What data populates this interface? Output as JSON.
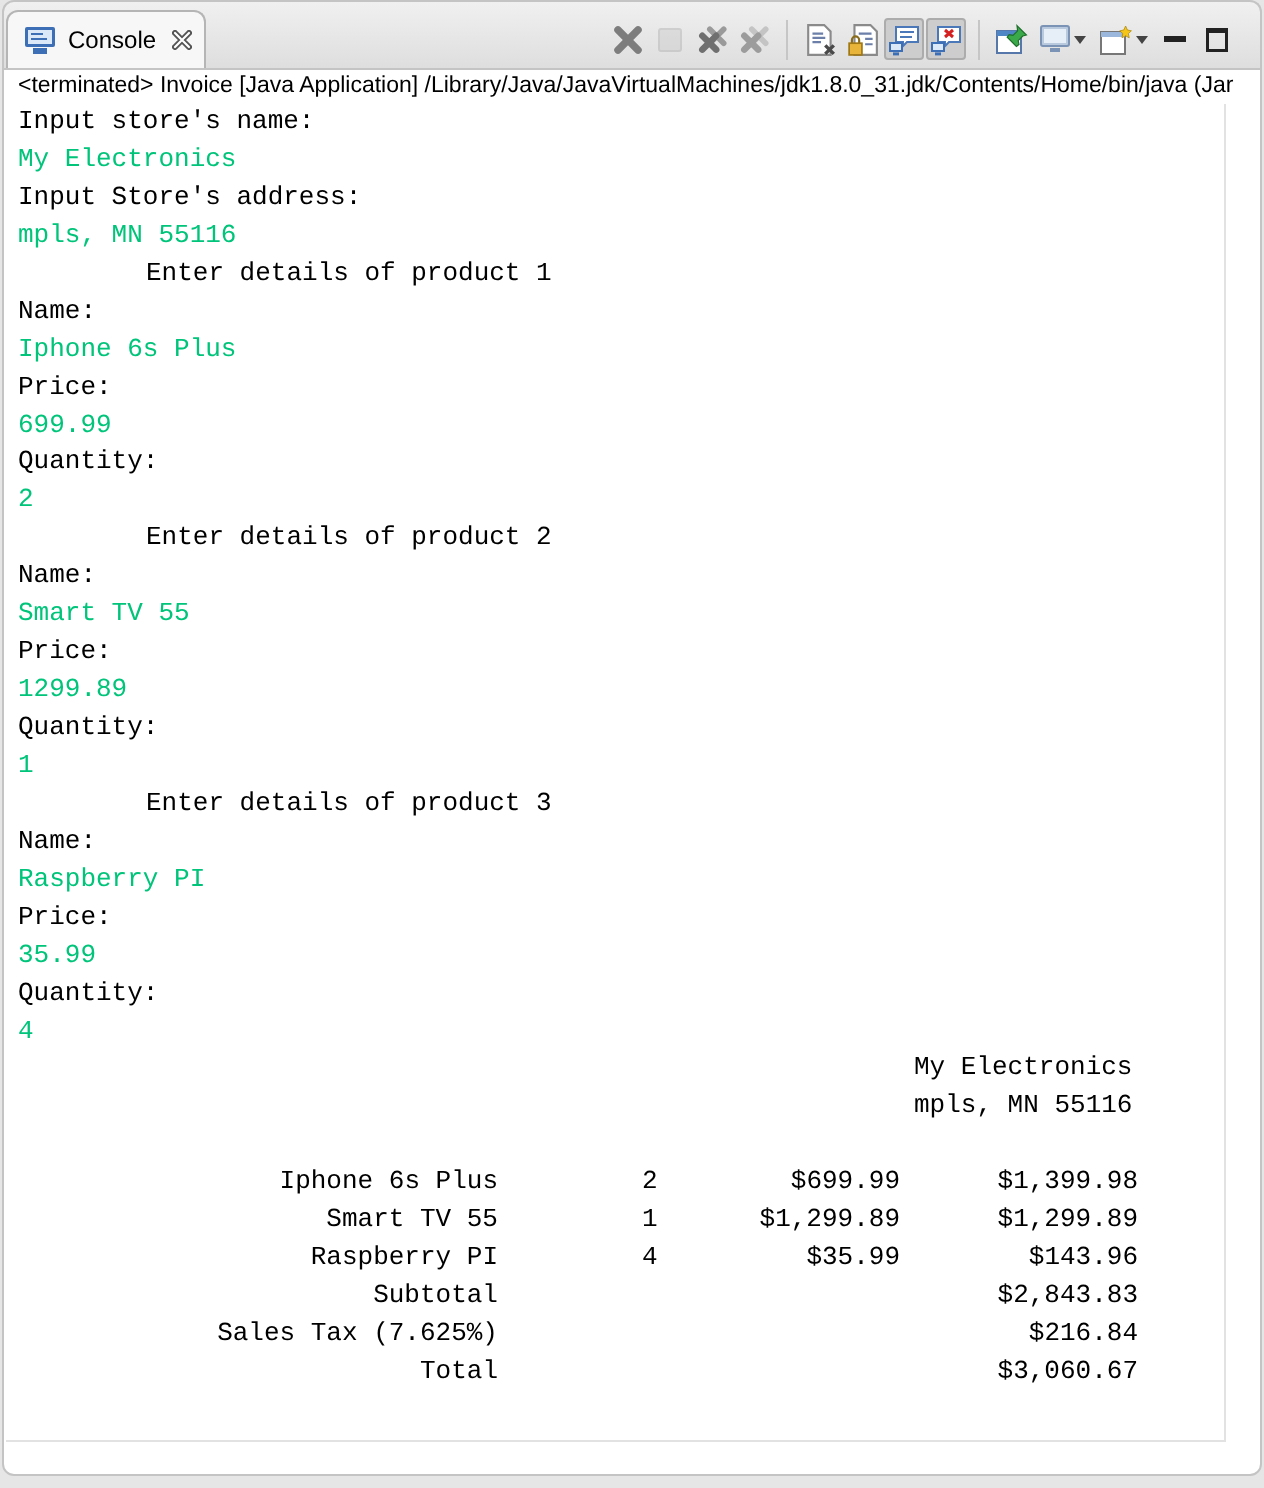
{
  "tabs": [
    {
      "label": "Console",
      "selected": true
    }
  ],
  "toolbar": [
    {
      "buttons": [
        {
          "kind": "x",
          "selected": false,
          "disabled": false,
          "dropdown": false
        },
        {
          "kind": "square",
          "selected": false,
          "disabled": true,
          "dropdown": false
        },
        {
          "kind": "double-x",
          "selected": false,
          "disabled": false,
          "dropdown": false
        },
        {
          "kind": "faded-double-x",
          "selected": false,
          "disabled": false,
          "dropdown": false
        }
      ]
    },
    {
      "buttons": [
        {
          "kind": "clear-doc",
          "selected": false,
          "disabled": false,
          "dropdown": false
        },
        {
          "kind": "lock-doc",
          "selected": false,
          "disabled": false,
          "dropdown": false
        },
        {
          "kind": "monitor-note",
          "selected": true,
          "disabled": false,
          "dropdown": false
        },
        {
          "kind": "monitor-error",
          "selected": true,
          "disabled": false,
          "dropdown": false
        }
      ]
    },
    {
      "buttons": [
        {
          "kind": "pin",
          "selected": false,
          "disabled": false,
          "dropdown": false
        },
        {
          "kind": "monitor",
          "selected": false,
          "disabled": false,
          "dropdown": true
        },
        {
          "kind": "new-window",
          "selected": false,
          "disabled": false,
          "dropdown": true
        }
      ]
    }
  ],
  "window_controls": [
    {
      "kind": "minimize"
    },
    {
      "kind": "maximize"
    }
  ],
  "process_label": "<terminated> Invoice [Java Application] /Library/Java/JavaVirtualMachines/jdk1.8.0_31.jdk/Contents/Home/bin/java (Jar",
  "console": {
    "lines": [
      {
        "kind": "prompt",
        "text": "Input store's name:"
      },
      {
        "kind": "input",
        "text": "My Electronics"
      },
      {
        "kind": "prompt",
        "text": "Input Store's address:"
      },
      {
        "kind": "input",
        "text": "mpls, MN 55116"
      },
      {
        "kind": "heading",
        "text": "Enter details of product 1"
      },
      {
        "kind": "prompt",
        "text": "Name:"
      },
      {
        "kind": "input",
        "text": "Iphone 6s Plus"
      },
      {
        "kind": "prompt",
        "text": "Price:"
      },
      {
        "kind": "input",
        "text": "699.99"
      },
      {
        "kind": "prompt",
        "text": "Quantity:"
      },
      {
        "kind": "input",
        "text": "2"
      },
      {
        "kind": "heading",
        "text": "Enter details of product 2"
      },
      {
        "kind": "prompt",
        "text": "Name:"
      },
      {
        "kind": "input",
        "text": "Smart TV 55"
      },
      {
        "kind": "prompt",
        "text": "Price:"
      },
      {
        "kind": "input",
        "text": "1299.89"
      },
      {
        "kind": "prompt",
        "text": "Quantity:"
      },
      {
        "kind": "input",
        "text": "1"
      },
      {
        "kind": "heading",
        "text": "Enter details of product 3"
      },
      {
        "kind": "prompt",
        "text": "Name:"
      },
      {
        "kind": "input",
        "text": "Raspberry PI"
      },
      {
        "kind": "prompt",
        "text": "Price:"
      },
      {
        "kind": "input",
        "text": "35.99"
      },
      {
        "kind": "prompt",
        "text": "Quantity:"
      },
      {
        "kind": "input",
        "text": "4"
      }
    ]
  },
  "invoice": {
    "store_name": "My Electronics",
    "store_address": "mpls, MN 55116",
    "items": [
      {
        "name": "Iphone 6s Plus",
        "quantity": "2",
        "price": "$699.99",
        "total": "$1,399.98"
      },
      {
        "name": "Smart TV 55",
        "quantity": "1",
        "price": "$1,299.89",
        "total": "$1,299.89"
      },
      {
        "name": "Raspberry PI",
        "quantity": "4",
        "price": "$35.99",
        "total": "$143.96"
      }
    ],
    "summary": [
      {
        "label": "Subtotal",
        "amount": "$2,843.83"
      },
      {
        "label": "Sales Tax (7.625%)",
        "amount": "$216.84"
      },
      {
        "label": "Total",
        "amount": "$3,060.67"
      }
    ]
  }
}
